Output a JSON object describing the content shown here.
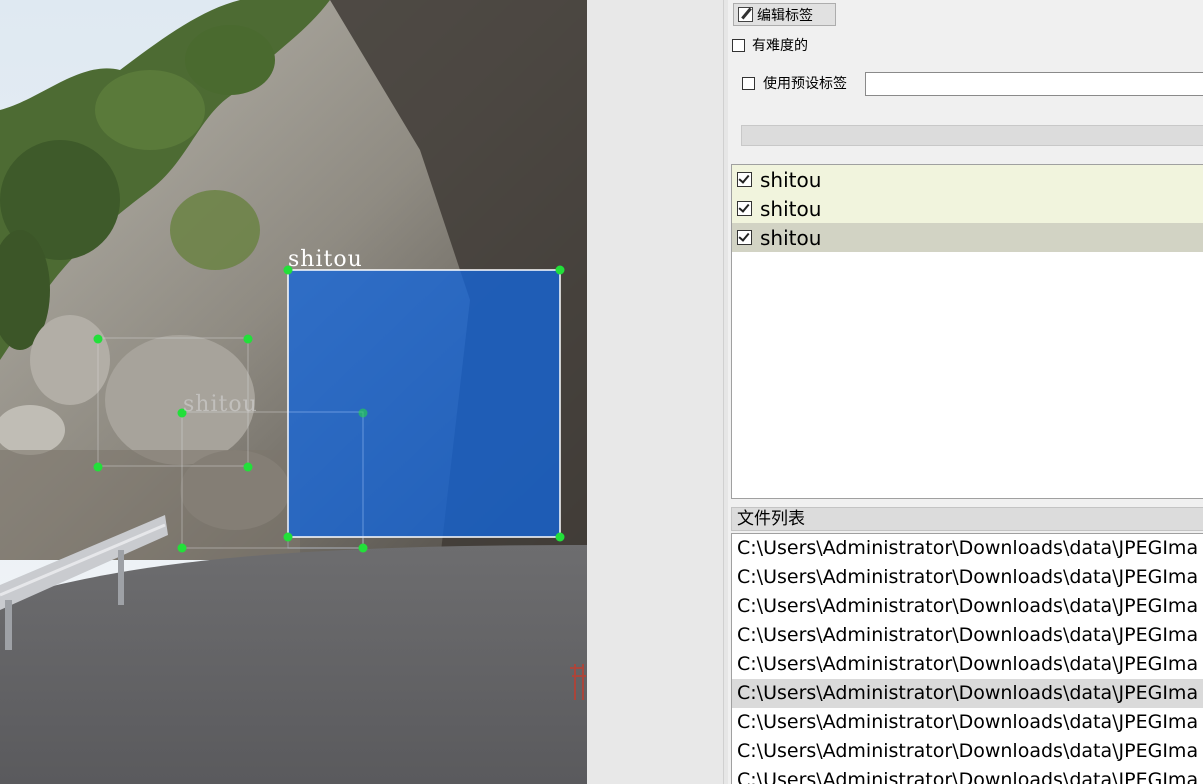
{
  "canvas": {
    "boxes": [
      {
        "label": "shitou",
        "state": "active",
        "fill": "#1565d8"
      },
      {
        "label": "shitou",
        "state": "faint",
        "fill": ""
      },
      {
        "label": "shitou",
        "state": "faint",
        "fill": ""
      }
    ],
    "handle_color": "#22e03a"
  },
  "toolbar": {
    "edit_label_button": "编辑标签",
    "edit_label_icon": "pencil-icon"
  },
  "options": {
    "difficult_label": "有难度的",
    "difficult_checked": false,
    "use_default_label": "使用预设标签",
    "use_default_checked": false,
    "default_label_value": "",
    "default_label_placeholder": ""
  },
  "label_list": {
    "items": [
      {
        "text": "shitou",
        "checked": true,
        "state": "highlight"
      },
      {
        "text": "shitou",
        "checked": true,
        "state": "highlight"
      },
      {
        "text": "shitou",
        "checked": true,
        "state": "selected"
      }
    ]
  },
  "file_list": {
    "title": "文件列表",
    "items": [
      "C:\\Users\\Administrator\\Downloads\\data\\JPEGIma",
      "C:\\Users\\Administrator\\Downloads\\data\\JPEGIma",
      "C:\\Users\\Administrator\\Downloads\\data\\JPEGIma",
      "C:\\Users\\Administrator\\Downloads\\data\\JPEGIma",
      "C:\\Users\\Administrator\\Downloads\\data\\JPEGIma",
      "C:\\Users\\Administrator\\Downloads\\data\\JPEGIma",
      "C:\\Users\\Administrator\\Downloads\\data\\JPEGIma",
      "C:\\Users\\Administrator\\Downloads\\data\\JPEGIma",
      "C:\\Users\\Administrator\\Downloads\\data\\JPEGIma"
    ],
    "selected_index": 5
  }
}
